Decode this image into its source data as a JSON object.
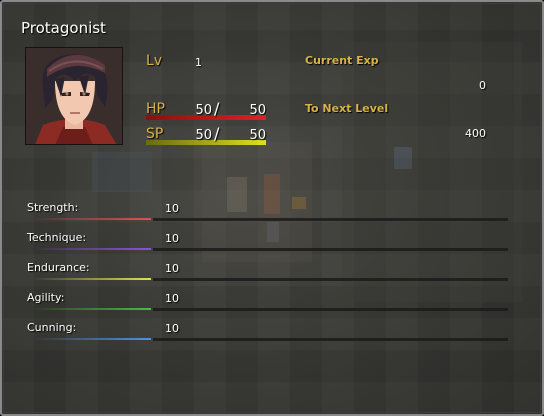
{
  "window": {
    "title": "Protagonist"
  },
  "portrait": {
    "icon": "character-portrait-icon"
  },
  "level": {
    "label": "Lv",
    "value": "1"
  },
  "exp": {
    "current_label": "Current Exp",
    "current_value": "0",
    "next_label": "To Next Level",
    "next_value": "400"
  },
  "gauges": {
    "hp": {
      "label": "HP",
      "current": "50",
      "slash": "/",
      "max": "50",
      "fill": 1.0,
      "color_start": "#8a1010",
      "color_end": "#e02020"
    },
    "sp": {
      "label": "SP",
      "current": "50",
      "slash": "/",
      "max": "50",
      "fill": 1.0,
      "color_start": "#6a6a10",
      "color_end": "#e0e020"
    }
  },
  "stats": [
    {
      "label": "Strength:",
      "value": "10",
      "color": "#e05050"
    },
    {
      "label": "Technique:",
      "value": "10",
      "color": "#8a50e0"
    },
    {
      "label": "Endurance:",
      "value": "10",
      "color": "#e0e050"
    },
    {
      "label": "Agility:",
      "value": "10",
      "color": "#40c040"
    },
    {
      "label": "Cunning:",
      "value": "10",
      "color": "#5090e0"
    }
  ],
  "colors": {
    "gold_label": "#d8b24a",
    "window_border": "#8a8a8a"
  }
}
